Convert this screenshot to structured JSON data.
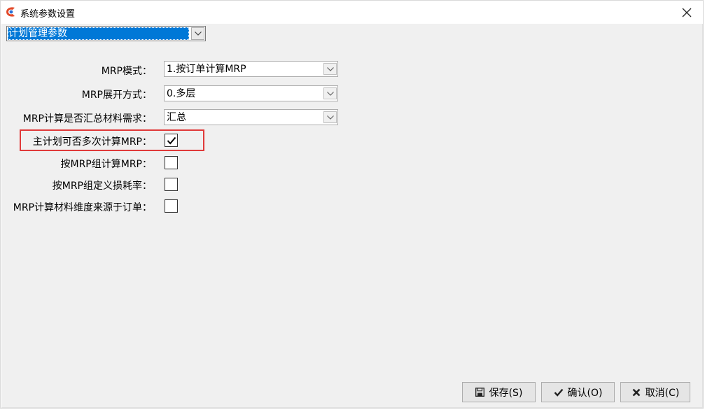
{
  "window": {
    "title": "系统参数设置"
  },
  "category": {
    "selected": "计划管理参数"
  },
  "settings": {
    "mrp_mode": {
      "label": "MRP模式：",
      "value": "1.按订单计算MRP"
    },
    "mrp_expand": {
      "label": "MRP展开方式：",
      "value": "0.多层"
    },
    "mrp_summary": {
      "label": "MRP计算是否汇总材料需求：",
      "value": "汇总"
    },
    "multi_calc": {
      "label": "主计划可否多次计算MRP：",
      "checked": true
    },
    "by_group": {
      "label": "按MRP组计算MRP：",
      "checked": false
    },
    "group_loss": {
      "label": "按MRP组定义损耗率：",
      "checked": false
    },
    "dim_source": {
      "label": "MRP计算材料维度来源于订单：",
      "checked": false
    }
  },
  "buttons": {
    "save": "保存(S)",
    "confirm": "确认(O)",
    "cancel": "取消(C)"
  },
  "colors": {
    "highlight": "#e03a3a",
    "selection": "#0078d7"
  }
}
